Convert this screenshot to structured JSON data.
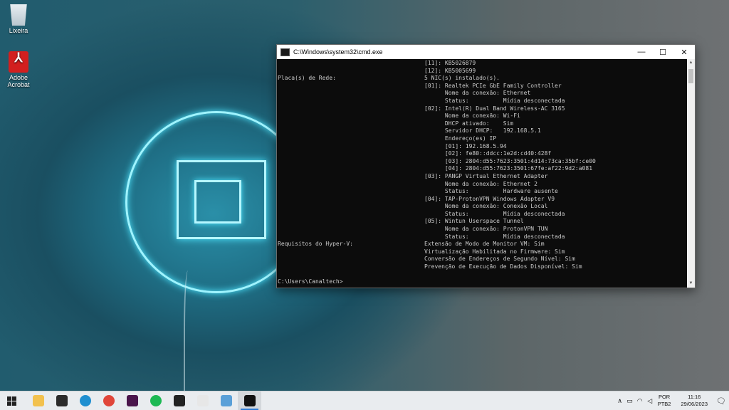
{
  "desktop": {
    "icons": [
      {
        "label": "Lixeira"
      },
      {
        "label": "Adobe Acrobat"
      }
    ]
  },
  "window": {
    "title": "C:\\Windows\\system32\\cmd.exe",
    "controls": {
      "minimize": "—",
      "maximize": "☐",
      "close": "✕"
    }
  },
  "console": {
    "lines": [
      {
        "k": "",
        "v": "[11]: KB5026879"
      },
      {
        "k": "",
        "v": "[12]: KB5005699"
      },
      {
        "k": "Placa(s) de Rede:",
        "v": "5 NIC(s) instalado(s)."
      },
      {
        "k": "",
        "v": "[01]: Realtek PCIe GbE Family Controller"
      },
      {
        "k": "",
        "v": "      Nome da conexão: Ethernet"
      },
      {
        "k": "",
        "v": "      Status:          Mídia desconectada"
      },
      {
        "k": "",
        "v": "[02]: Intel(R) Dual Band Wireless-AC 3165"
      },
      {
        "k": "",
        "v": "      Nome da conexão: Wi-Fi"
      },
      {
        "k": "",
        "v": "      DHCP ativado:    Sim"
      },
      {
        "k": "",
        "v": "      Servidor DHCP:   192.168.5.1"
      },
      {
        "k": "",
        "v": "      Endereço(es) IP"
      },
      {
        "k": "",
        "v": "      [01]: 192.168.5.94"
      },
      {
        "k": "",
        "v": "      [02]: fe80::ddcc:1e2d:cd40:428f"
      },
      {
        "k": "",
        "v": "      [03]: 2804:d55:7623:3501:4d14:73ca:35bf:ce00"
      },
      {
        "k": "",
        "v": "      [04]: 2804:d55:7623:3501:67fe:af22:9d2:a081"
      },
      {
        "k": "",
        "v": "[03]: PANGP Virtual Ethernet Adapter"
      },
      {
        "k": "",
        "v": "      Nome da conexão: Ethernet 2"
      },
      {
        "k": "",
        "v": "      Status:          Hardware ausente"
      },
      {
        "k": "",
        "v": "[04]: TAP-ProtonVPN Windows Adapter V9"
      },
      {
        "k": "",
        "v": "      Nome da conexão: Conexão Local"
      },
      {
        "k": "",
        "v": "      Status:          Mídia desconectada"
      },
      {
        "k": "",
        "v": "[05]: Wintun Userspace Tunnel"
      },
      {
        "k": "",
        "v": "      Nome da conexão: ProtonVPN TUN"
      },
      {
        "k": "",
        "v": "      Status:          Mídia desconectada"
      },
      {
        "k": "Requisitos do Hyper-V:",
        "v": "Extensão de Modo de Monitor VM: Sim"
      },
      {
        "k": "",
        "v": "Virtualização Habilitada no Firmware: Sim"
      },
      {
        "k": "",
        "v": "Conversão de Endereços de Segundo Nível: Sim"
      },
      {
        "k": "",
        "v": "Prevenção de Execução de Dados Disponível: Sim"
      },
      {
        "k": "",
        "v": ""
      },
      {
        "k": "C:\\Users\\Canaltech>",
        "v": ""
      }
    ]
  },
  "taskbar": {
    "apps": [
      {
        "name": "file-explorer",
        "color": "#f2c14e"
      },
      {
        "name": "sticky-notes",
        "color": "#2b2b2b"
      },
      {
        "name": "edge",
        "color": "#1f8fd0"
      },
      {
        "name": "chrome",
        "color": "#e0463a"
      },
      {
        "name": "slack",
        "color": "#4a154b"
      },
      {
        "name": "spotify",
        "color": "#1db954"
      },
      {
        "name": "davinci",
        "color": "#222222"
      },
      {
        "name": "paint",
        "color": "#e7e7e7"
      },
      {
        "name": "photos",
        "color": "#5aa0d8"
      },
      {
        "name": "cmd",
        "color": "#111111"
      }
    ],
    "tray": {
      "chevron": "∧",
      "lang_top": "POR",
      "lang_bottom": "PTB2",
      "time": "11:16",
      "date": "29/06/2023",
      "notifications": "🗨"
    }
  }
}
